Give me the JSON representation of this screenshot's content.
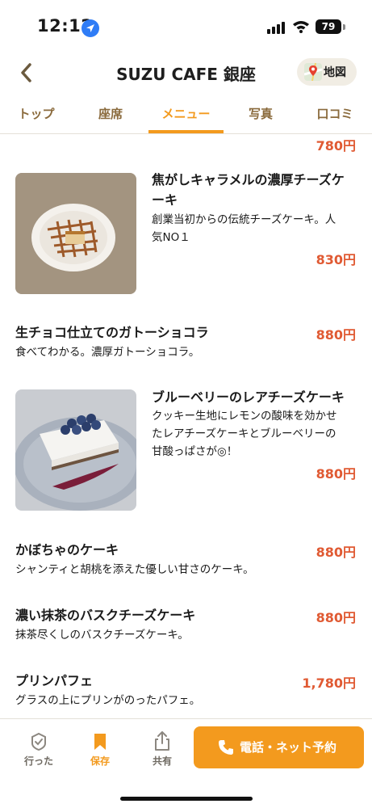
{
  "status_bar": {
    "time": "12:12",
    "battery": "79"
  },
  "header": {
    "title": "SUZU CAFE 銀座",
    "map_label": "地図"
  },
  "tabs": [
    {
      "label": "トップ",
      "active": false
    },
    {
      "label": "座席",
      "active": false
    },
    {
      "label": "メニュー",
      "active": true
    },
    {
      "label": "写真",
      "active": false
    },
    {
      "label": "口コミ",
      "active": false
    }
  ],
  "menu": {
    "prev_price": "780円",
    "items": [
      {
        "name_line1": "焦がしキャラメルの濃厚チーズケ",
        "name_line2": "ーキ",
        "desc_line1": "創業当初からの伝統チーズケーキ。人",
        "desc_line2": "気NO１",
        "price": "830円",
        "photo": "caramel-cheesecake"
      },
      {
        "name": "生チョコ仕立てのガトーショコラ",
        "desc": "食べてわかる。濃厚ガトーショコラ。",
        "price": "880円"
      },
      {
        "name": "ブルーベリーのレアチーズケーキ",
        "desc_line1": "クッキー生地にレモンの酸味を効かせ",
        "desc_line2": "たレアチーズケーキとブルーベリーの",
        "desc_line3": "甘酸っぱさが◎！",
        "price": "880円",
        "photo": "blueberry-cheesecake"
      },
      {
        "name": "かぼちゃのケーキ",
        "desc": "シャンティと胡桃を添えた優しい甘さのケーキ。",
        "price": "880円"
      },
      {
        "name": "濃い抹茶のバスクチーズケーキ",
        "desc": "抹茶尽くしのバスクチーズケーキ。",
        "price": "880円"
      },
      {
        "name": "プリンパフェ",
        "desc": "グラスの上にプリンがのったパフェ。",
        "price": "1,780円"
      }
    ]
  },
  "bottom_bar": {
    "went_label": "行った",
    "save_label": "保存",
    "share_label": "共有",
    "reserve_label": "電話・ネット予約"
  },
  "colors": {
    "accent": "#f39a1e",
    "price": "#e05a33",
    "tab_text": "#8a6a3c"
  }
}
